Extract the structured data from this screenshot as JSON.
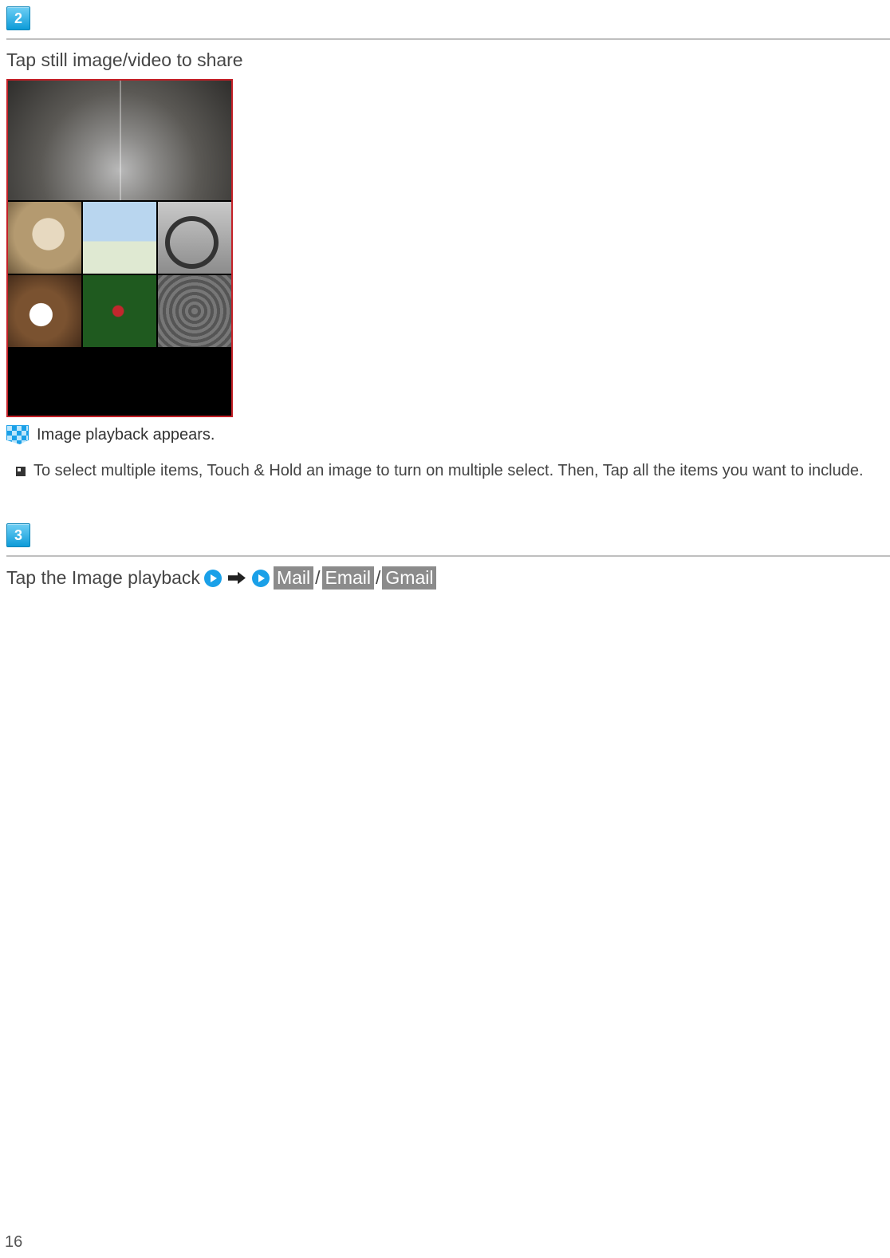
{
  "step2": {
    "number": "2",
    "title": "Tap still image/video to share",
    "note": "Image playback appears.",
    "bullet": "To select multiple items, Touch & Hold an image to turn on multiple select. Then, Tap all the items you want to include."
  },
  "step3": {
    "number": "3",
    "line_prefix": "Tap the Image playback",
    "opt1": "Mail",
    "opt2": "Email",
    "opt3": "Gmail",
    "slash": "/"
  },
  "page_number": "16"
}
